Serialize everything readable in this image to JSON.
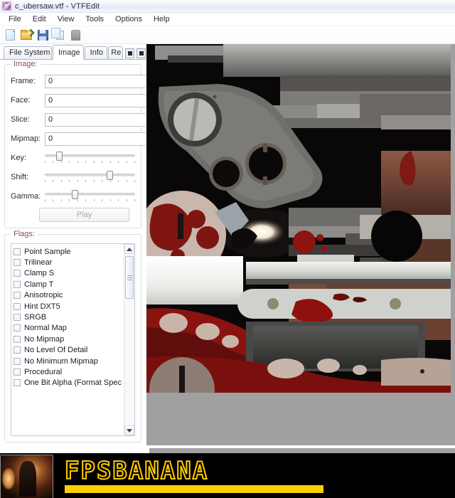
{
  "window": {
    "title": "c_ubersaw.vtf - VTFEdit",
    "icon": "vtfedit-app-icon"
  },
  "menubar": {
    "items": [
      {
        "label": "File"
      },
      {
        "label": "Edit"
      },
      {
        "label": "View"
      },
      {
        "label": "Tools"
      },
      {
        "label": "Options"
      },
      {
        "label": "Help"
      }
    ]
  },
  "toolbar": {
    "buttons": [
      {
        "name": "new-file-icon",
        "title": "New"
      },
      {
        "name": "open-file-icon",
        "title": "Open"
      },
      {
        "name": "save-file-icon",
        "title": "Save"
      },
      {
        "name": "copy-icon",
        "title": "Copy"
      },
      {
        "name": "export-icon",
        "title": "Export"
      }
    ]
  },
  "tabs": {
    "items": [
      {
        "label": "File System",
        "active": false
      },
      {
        "label": "Image",
        "active": true
      },
      {
        "label": "Info",
        "active": false
      },
      {
        "label": "Re",
        "active": false,
        "clipped": true
      }
    ],
    "scroll_left": "◀",
    "scroll_right": "▶"
  },
  "image_group": {
    "label": "Image:",
    "fields": [
      {
        "label": "Frame:",
        "value": "0"
      },
      {
        "label": "Face:",
        "value": "0"
      },
      {
        "label": "Slice:",
        "value": "0"
      },
      {
        "label": "Mipmap:",
        "value": "0"
      }
    ],
    "sliders": [
      {
        "label": "Key:",
        "value": 16
      },
      {
        "label": "Shift:",
        "value": 72
      },
      {
        "label": "Gamma:",
        "value": 33
      }
    ],
    "play_label": "Play"
  },
  "flags_group": {
    "label": "Flags:",
    "items": [
      {
        "label": "Point Sample",
        "checked": false
      },
      {
        "label": "Trilinear",
        "checked": false
      },
      {
        "label": "Clamp S",
        "checked": false
      },
      {
        "label": "Clamp T",
        "checked": false
      },
      {
        "label": "Anisotropic",
        "checked": false
      },
      {
        "label": "Hint DXT5",
        "checked": false
      },
      {
        "label": "SRGB",
        "checked": false
      },
      {
        "label": "Normal Map",
        "checked": false
      },
      {
        "label": "No Mipmap",
        "checked": false
      },
      {
        "label": "No Level Of Detail",
        "checked": false
      },
      {
        "label": "No Minimum Mipmap",
        "checked": false
      },
      {
        "label": "Procedural",
        "checked": false
      },
      {
        "label": "One Bit Alpha (Format Spec",
        "checked": false
      }
    ]
  },
  "preview": {
    "name": "texture-preview",
    "background_color": "#a0a0a0"
  },
  "watermark": {
    "text": "FPSBANANA",
    "accent_color": "#ffcc00",
    "background_color": "#000000"
  }
}
